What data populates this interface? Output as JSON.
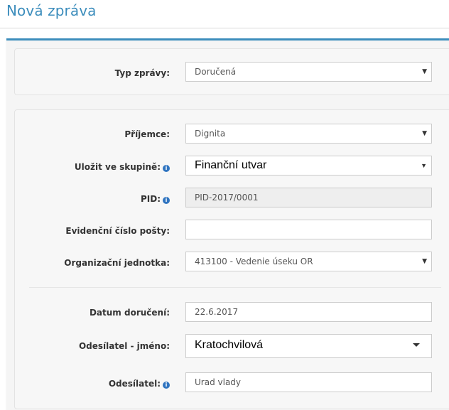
{
  "page": {
    "title": "Nová zpráva"
  },
  "type_panel": {
    "typ_zpravy": {
      "label": "Typ zprávy:",
      "value": "Doručená"
    }
  },
  "form": {
    "prijemce": {
      "label": "Příjemce:",
      "value": "Dignita"
    },
    "ulozit_ve_skupine": {
      "label": "Uložit ve skupině:",
      "value": "Finanční utvar"
    },
    "pid": {
      "label": "PID:",
      "value": "PID-2017/0001"
    },
    "evidencni_cislo": {
      "label": "Evidenční číslo pošty:",
      "value": ""
    },
    "organizacni_jednotka": {
      "label": "Organizační jednotka:",
      "value": "413100 - Vedenie úseku OR"
    },
    "datum_doruceni": {
      "label": "Datum doručení:",
      "value": "22.6.2017"
    },
    "odesilatel_jmeno": {
      "label": "Odesílatel - jméno:",
      "value": "Kratochvilová"
    },
    "odesilatel": {
      "label": "Odesílatel:",
      "value": "Urad vlady"
    }
  },
  "icons": {
    "info": "info-icon",
    "dropdown": "caret-down-icon"
  },
  "colors": {
    "accent": "#3c8dbc",
    "info": "#2f74c0"
  }
}
